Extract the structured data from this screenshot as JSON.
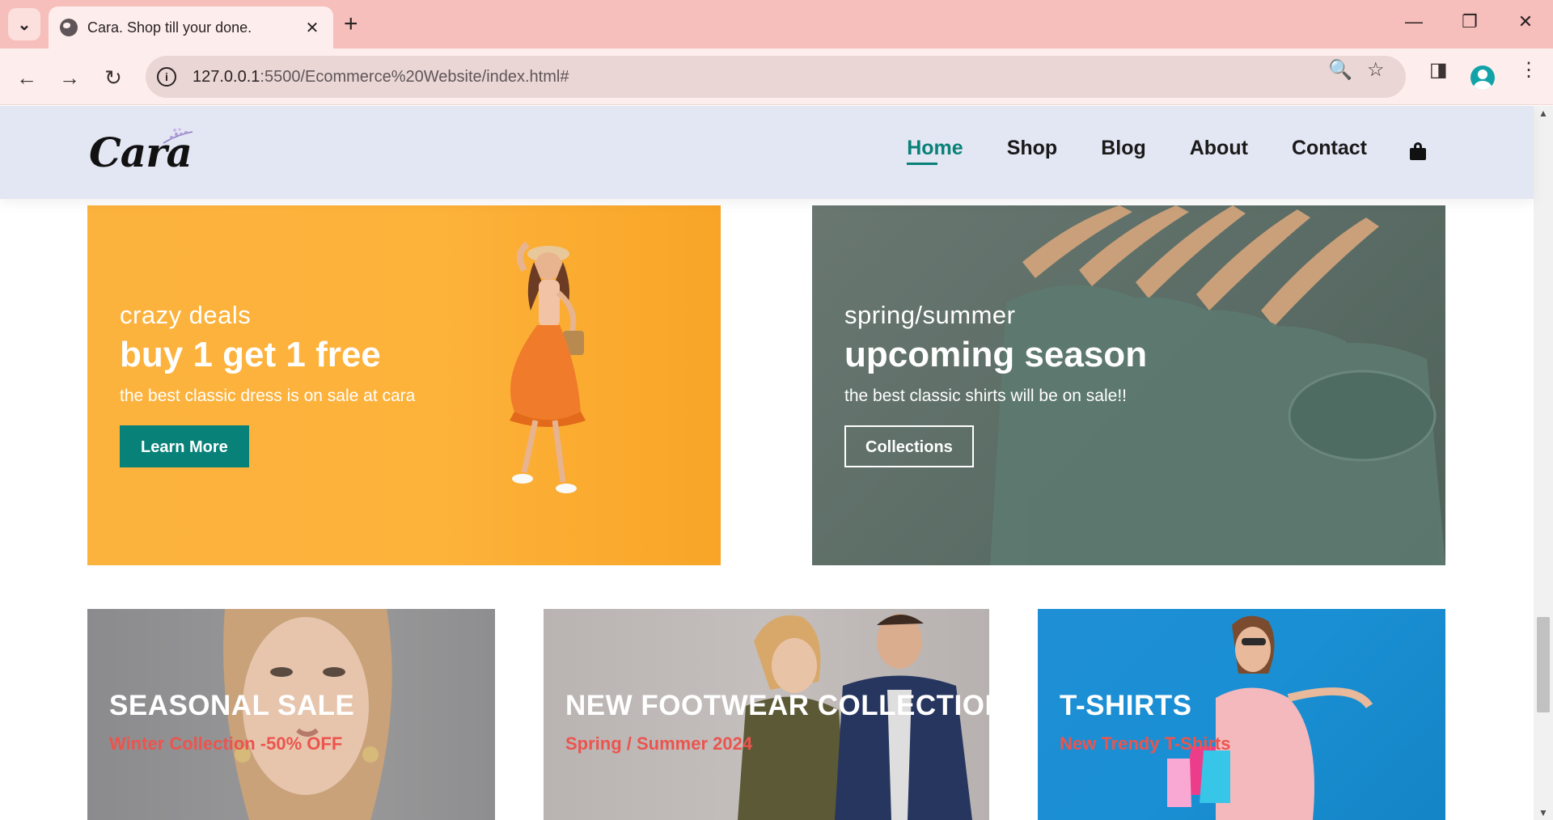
{
  "browser": {
    "tab_title": "Cara. Shop till your done.",
    "new_tab": "+",
    "url_host": "127.0.0.1",
    "url_path": ":5500/Ecommerce%20Website/index.html#",
    "controls": {
      "minimize": "—",
      "restore": "❐",
      "close": "✕",
      "tab_close": "✕",
      "tab_menu": "⌄"
    },
    "nav": {
      "back": "←",
      "forward": "→",
      "reload": "↻"
    },
    "icons": {
      "zoom": "🔍",
      "star": "☆",
      "sidebar": "◨",
      "menu": "⋮"
    }
  },
  "site": {
    "logo_text": "Cara",
    "nav_items": [
      "Home",
      "Shop",
      "Blog",
      "About",
      "Contact"
    ],
    "active_nav": "Home",
    "accent_color": "#088178",
    "header_bg": "#e3e6f3"
  },
  "banners": {
    "deal": {
      "eyebrow": "crazy deals",
      "headline": "buy 1 get 1 free",
      "subtext": "the best classic dress is on sale at cara",
      "button": "Learn More"
    },
    "season": {
      "eyebrow": "spring/summer",
      "headline": "upcoming season",
      "subtext": "the best classic shirts will be on sale!!",
      "button": "Collections"
    },
    "lower": [
      {
        "title": "SEASONAL SALE",
        "subtitle": "Winter Collection -50% OFF"
      },
      {
        "title": "NEW FOOTWEAR COLLECTION",
        "subtitle": "Spring / Summer 2024"
      },
      {
        "title": "T-SHIRTS",
        "subtitle": "New Trendy T-Shirts"
      }
    ],
    "subtitle_color": "#ec544e"
  }
}
